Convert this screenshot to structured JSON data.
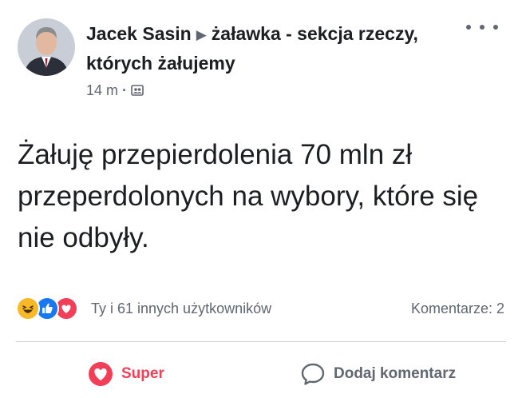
{
  "post": {
    "author": "Jacek Sasin",
    "group": "żaławka - sekcja rzeczy, których żałujemy",
    "time": "14 m",
    "text": "Żałuję przepierdolenia 70 mln zł przeperdolonych na wybory, które się nie odbyły."
  },
  "reactions": {
    "types": [
      "haha",
      "like",
      "love"
    ],
    "summary": "Ty i 61 innych użytkowników",
    "comments": "Komentarze: 2"
  },
  "actions": {
    "reaction_label": "Super",
    "comment_label": "Dodaj komentarz"
  },
  "colors": {
    "love": "#f33e58",
    "like": "#1877f2",
    "haha": "#f7b928",
    "secondary_text": "#606770"
  }
}
